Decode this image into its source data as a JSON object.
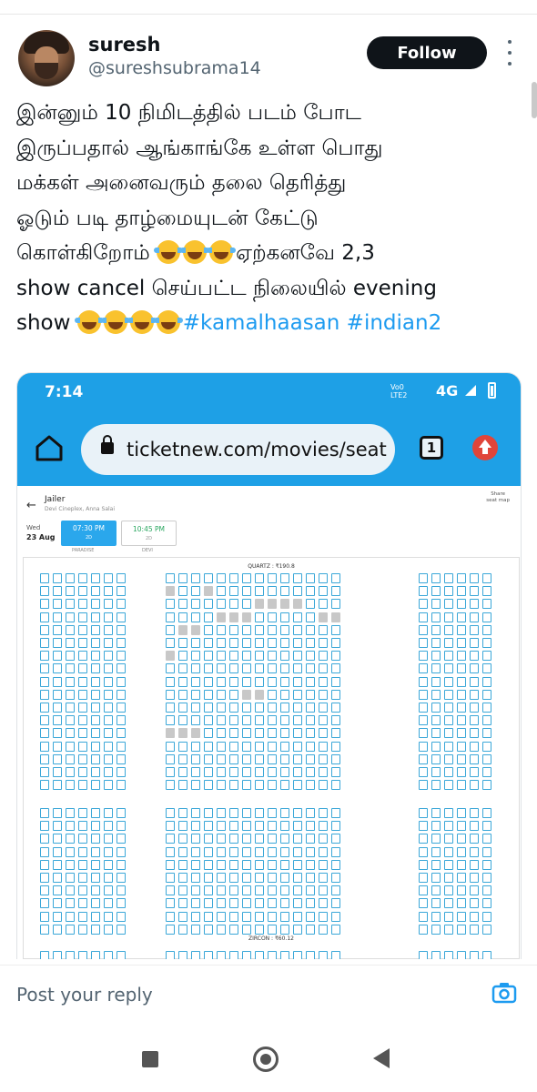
{
  "author": {
    "name": "suresh",
    "handle": "@sureshsubrama14",
    "follow_label": "Follow"
  },
  "tweet": {
    "line1": "இன்னும் 10 நிமிடத்தில் படம் போட",
    "line2": "இருப்பதால் ஆங்காங்கே உள்ள பொது",
    "line3": "மக்கள் அனைவரும் தலை தெரித்து",
    "line4": "ஓடும் படி தாழ்மையுடன் கேட்டு",
    "line5_a": "கொள்கிறோம் ",
    "line5_b": "ஏற்கனவே 2,3",
    "line6": "show cancel செய்பட்ட நிலையில் evening",
    "line7_a": "show ",
    "hashtag1": "#kamalhaasan",
    "hashtag2": "#indian2",
    "emoji_name": "face-with-tears-of-joy"
  },
  "screenshot": {
    "status": {
      "time": "7:14",
      "volte": "Vo0\nLTE2",
      "network": "4G"
    },
    "browser": {
      "url": "ticketnew.com/movies/seat",
      "tab_count": "1"
    },
    "movie": {
      "title": "Jailer",
      "cinema": "Devi Cineplex, Anna Salai",
      "share": "Share\nseat map"
    },
    "date": {
      "day": "Wed",
      "date": "23 Aug"
    },
    "shows": [
      {
        "time": "07:30 PM",
        "format": "2D",
        "screen": "PARADISE"
      },
      {
        "time": "10:45 PM",
        "format": "2D",
        "screen": "DEVI"
      }
    ],
    "classes": {
      "top": "QUARTZ : ₹190.8",
      "bottom": "ZIRCON : ₹60.12"
    }
  },
  "reply": {
    "placeholder": "Post your reply"
  },
  "colors": {
    "accent": "#1d9bf0",
    "browser_bar": "#1ea0e6",
    "seat_border": "#3aa7d8",
    "sold_seat": "#c8c8c8"
  },
  "icons": [
    "more-icon",
    "home-icon",
    "lock-icon",
    "tabs-icon",
    "update-icon",
    "camera-icon",
    "back-arrow-icon"
  ]
}
